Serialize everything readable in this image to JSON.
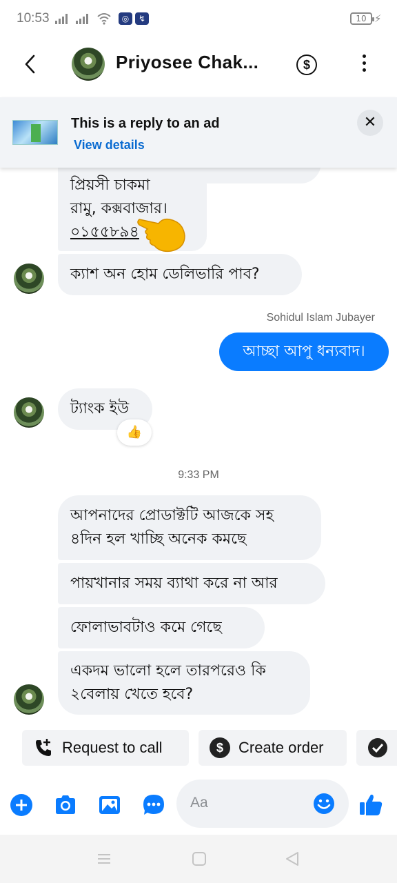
{
  "status_bar": {
    "time": "10:53",
    "battery": "10"
  },
  "header": {
    "contact_name": "Priyosee Chak...",
    "dollar_symbol": "$"
  },
  "ad_banner": {
    "title": "This is a reply to an ad",
    "link": "View details",
    "close_symbol": "✕"
  },
  "messages": [
    {
      "text_lines": [
        "প্রিয়সী চাকমা",
        "রামু, কক্সবাজার।",
        "০১৫৫৮৯৪"
      ],
      "direction": "in"
    },
    {
      "text": "ক্যাশ অন হোম ডেলিভারি পাব?",
      "direction": "in"
    },
    {
      "sender": "Sohidul Islam Jubayer",
      "text": "আচ্ছা আপু ধন্যবাদ।",
      "direction": "out"
    },
    {
      "text": "ট্যাংক ইউ",
      "direction": "in",
      "reaction": "👍"
    },
    {
      "timestamp": "9:33 PM"
    },
    {
      "text_lines": [
        "আপনাদের প্রোডাক্টটি আজকে সহ",
        "৪দিন হল খাচ্ছি অনেক কমছে"
      ],
      "direction": "in"
    },
    {
      "text": "পায়খানার সময় ব্যাথা করে না আর",
      "direction": "in"
    },
    {
      "text": "ফোলাভাবটাও  কমে গেছে",
      "direction": "in"
    },
    {
      "text_lines": [
        "একদম ভালো হলে তারপরেও কি",
        "২বেলায় খেতে হবে?"
      ],
      "direction": "in"
    }
  ],
  "quick_replies": [
    {
      "label": "Request to call",
      "icon": "phone-plus-icon"
    },
    {
      "label": "Create order",
      "icon": "dollar-icon"
    },
    {
      "label": "",
      "icon": "check-circle-icon"
    }
  ],
  "composer": {
    "placeholder": "Aa"
  },
  "accent_color": "#0a7cff"
}
